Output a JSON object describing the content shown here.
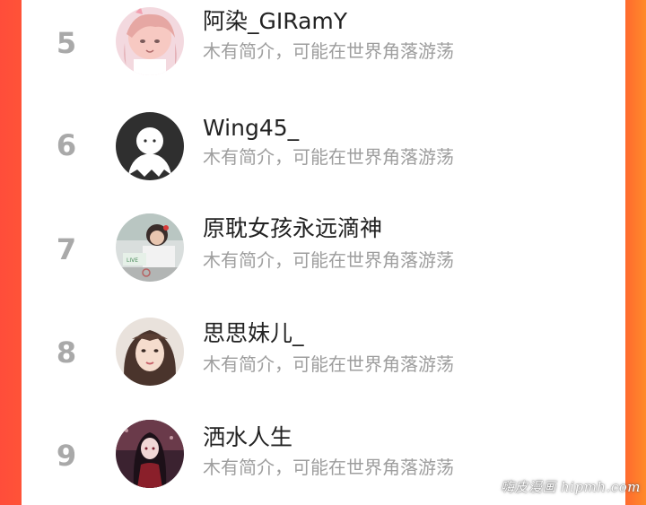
{
  "list": {
    "items": [
      {
        "rank": "5",
        "name": "阿染_GIRamY",
        "bio": "木有简介，可能在世界角落游荡",
        "avatar": "anime-girl-avatar"
      },
      {
        "rank": "6",
        "name": "Wing45_",
        "bio": "木有简介，可能在世界角落游荡",
        "avatar": "default-ghost-avatar"
      },
      {
        "rank": "7",
        "name": "原耽女孩永远滴神",
        "bio": "木有简介，可能在世界角落游荡",
        "avatar": "photo-avatar"
      },
      {
        "rank": "8",
        "name": "思思妹儿_",
        "bio": "木有简介，可能在世界角落游荡",
        "avatar": "portrait-avatar"
      },
      {
        "rank": "9",
        "name": "洒水人生",
        "bio": "木有简介，可能在世界角落游荡",
        "avatar": "dark-anime-avatar"
      }
    ]
  },
  "watermark": "嗨皮漫画 hipmh.com",
  "colors": {
    "left_edge": "#ff4d3a",
    "right_edge": "#ff7a2c",
    "rank_text": "#a9a9a9",
    "name_text": "#222222",
    "bio_text": "#9e9e9e"
  }
}
